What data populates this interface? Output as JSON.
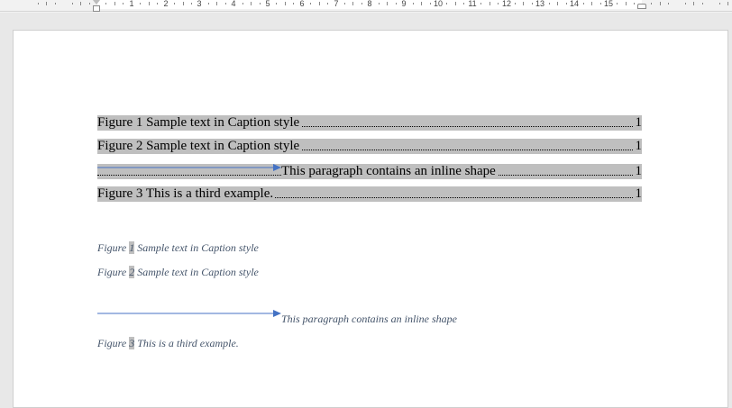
{
  "ruler": {
    "numbers": [
      "1",
      "2",
      "3",
      "4",
      "5",
      "6",
      "7",
      "8",
      "9",
      "10",
      "11",
      "12",
      "13",
      "14",
      "15"
    ]
  },
  "toc": [
    {
      "label": "Figure 1 Sample text in Caption style",
      "page": "1",
      "has_shape": false
    },
    {
      "label": "Figure 2 Sample text in Caption style",
      "page": "1",
      "has_shape": false
    },
    {
      "label": "This paragraph contains an inline shape",
      "page": "1",
      "has_shape": true
    },
    {
      "label": "Figure 3 This is a third example.",
      "page": "1",
      "has_shape": false
    }
  ],
  "captions": [
    {
      "prefix": "Figure ",
      "num": "1",
      "text": " Sample text in Caption style"
    },
    {
      "prefix": "Figure ",
      "num": "2",
      "text": " Sample text in Caption style"
    },
    {
      "text": "This paragraph contains an inline shape"
    },
    {
      "prefix": "Figure ",
      "num": "3",
      "text": " This is a third example."
    }
  ],
  "colors": {
    "field_shading": "#bfbfbf",
    "caption_text": "#44546a",
    "arrow": "#4472c4"
  },
  "icons": {
    "inline_shape": "right-arrow-icon"
  }
}
